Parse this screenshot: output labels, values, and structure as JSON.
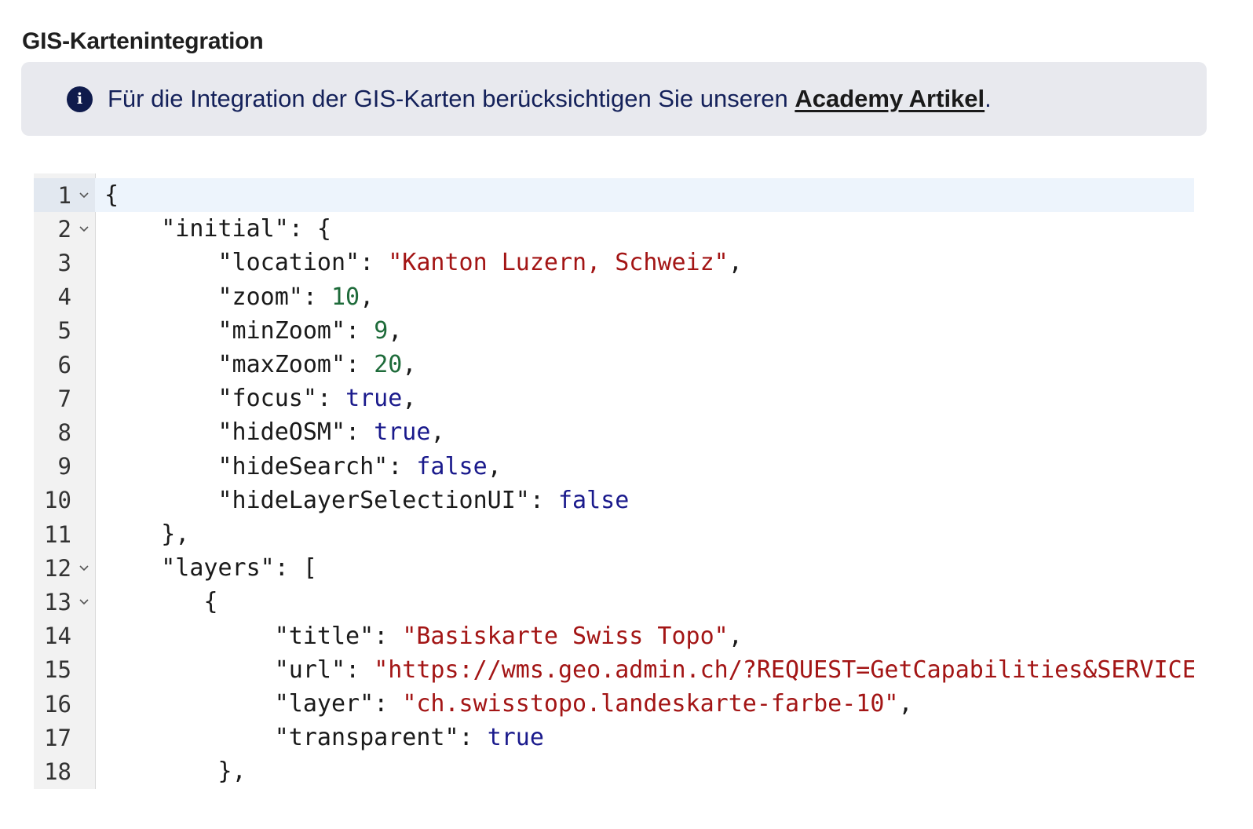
{
  "section": {
    "title": "GIS-Kartenintegration"
  },
  "info": {
    "icon": "info-icon",
    "text": "Für die Integration der GIS-Karten berücksichtigen Sie unseren ",
    "link_label": "Academy Artikel",
    "suffix": "."
  },
  "editor": {
    "active_line": 1,
    "lines": [
      {
        "n": "1",
        "fold": true,
        "indent": 0,
        "tokens": [
          [
            "pun",
            "{"
          ]
        ]
      },
      {
        "n": "2",
        "fold": true,
        "indent": 4,
        "tokens": [
          [
            "key",
            "\"initial\""
          ],
          [
            "pun",
            ": {"
          ]
        ]
      },
      {
        "n": "3",
        "fold": false,
        "indent": 8,
        "tokens": [
          [
            "key",
            "\"location\""
          ],
          [
            "pun",
            ": "
          ],
          [
            "str",
            "\"Kanton Luzern, Schweiz\""
          ],
          [
            "pun",
            ","
          ]
        ]
      },
      {
        "n": "4",
        "fold": false,
        "indent": 8,
        "tokens": [
          [
            "key",
            "\"zoom\""
          ],
          [
            "pun",
            ": "
          ],
          [
            "num",
            "10"
          ],
          [
            "pun",
            ","
          ]
        ]
      },
      {
        "n": "5",
        "fold": false,
        "indent": 8,
        "tokens": [
          [
            "key",
            "\"minZoom\""
          ],
          [
            "pun",
            ": "
          ],
          [
            "num",
            "9"
          ],
          [
            "pun",
            ","
          ]
        ]
      },
      {
        "n": "6",
        "fold": false,
        "indent": 8,
        "tokens": [
          [
            "key",
            "\"maxZoom\""
          ],
          [
            "pun",
            ": "
          ],
          [
            "num",
            "20"
          ],
          [
            "pun",
            ","
          ]
        ]
      },
      {
        "n": "7",
        "fold": false,
        "indent": 8,
        "tokens": [
          [
            "key",
            "\"focus\""
          ],
          [
            "pun",
            ": "
          ],
          [
            "bool",
            "true"
          ],
          [
            "pun",
            ","
          ]
        ]
      },
      {
        "n": "8",
        "fold": false,
        "indent": 8,
        "tokens": [
          [
            "key",
            "\"hideOSM\""
          ],
          [
            "pun",
            ": "
          ],
          [
            "bool",
            "true"
          ],
          [
            "pun",
            ","
          ]
        ]
      },
      {
        "n": "9",
        "fold": false,
        "indent": 8,
        "tokens": [
          [
            "key",
            "\"hideSearch\""
          ],
          [
            "pun",
            ": "
          ],
          [
            "bool",
            "false"
          ],
          [
            "pun",
            ","
          ]
        ]
      },
      {
        "n": "10",
        "fold": false,
        "indent": 8,
        "tokens": [
          [
            "key",
            "\"hideLayerSelectionUI\""
          ],
          [
            "pun",
            ": "
          ],
          [
            "bool",
            "false"
          ]
        ]
      },
      {
        "n": "11",
        "fold": false,
        "indent": 4,
        "tokens": [
          [
            "pun",
            "},"
          ]
        ]
      },
      {
        "n": "12",
        "fold": true,
        "indent": 4,
        "tokens": [
          [
            "key",
            "\"layers\""
          ],
          [
            "pun",
            ": ["
          ]
        ]
      },
      {
        "n": "13",
        "fold": true,
        "indent": 7,
        "tokens": [
          [
            "pun",
            "{"
          ]
        ]
      },
      {
        "n": "14",
        "fold": false,
        "indent": 12,
        "tokens": [
          [
            "key",
            "\"title\""
          ],
          [
            "pun",
            ": "
          ],
          [
            "str",
            "\"Basiskarte Swiss Topo\""
          ],
          [
            "pun",
            ","
          ]
        ]
      },
      {
        "n": "15",
        "fold": false,
        "indent": 12,
        "tokens": [
          [
            "key",
            "\"url\""
          ],
          [
            "pun",
            ": "
          ],
          [
            "str",
            "\"https://wms.geo.admin.ch/?REQUEST=GetCapabilities&SERVICE=WMS\""
          ],
          [
            "pun",
            ","
          ]
        ]
      },
      {
        "n": "16",
        "fold": false,
        "indent": 12,
        "tokens": [
          [
            "key",
            "\"layer\""
          ],
          [
            "pun",
            ": "
          ],
          [
            "str",
            "\"ch.swisstopo.landeskarte-farbe-10\""
          ],
          [
            "pun",
            ","
          ]
        ]
      },
      {
        "n": "17",
        "fold": false,
        "indent": 12,
        "tokens": [
          [
            "key",
            "\"transparent\""
          ],
          [
            "pun",
            ": "
          ],
          [
            "bool",
            "true"
          ]
        ]
      },
      {
        "n": "18",
        "fold": false,
        "indent": 8,
        "tokens": [
          [
            "pun",
            "},"
          ]
        ]
      }
    ]
  }
}
